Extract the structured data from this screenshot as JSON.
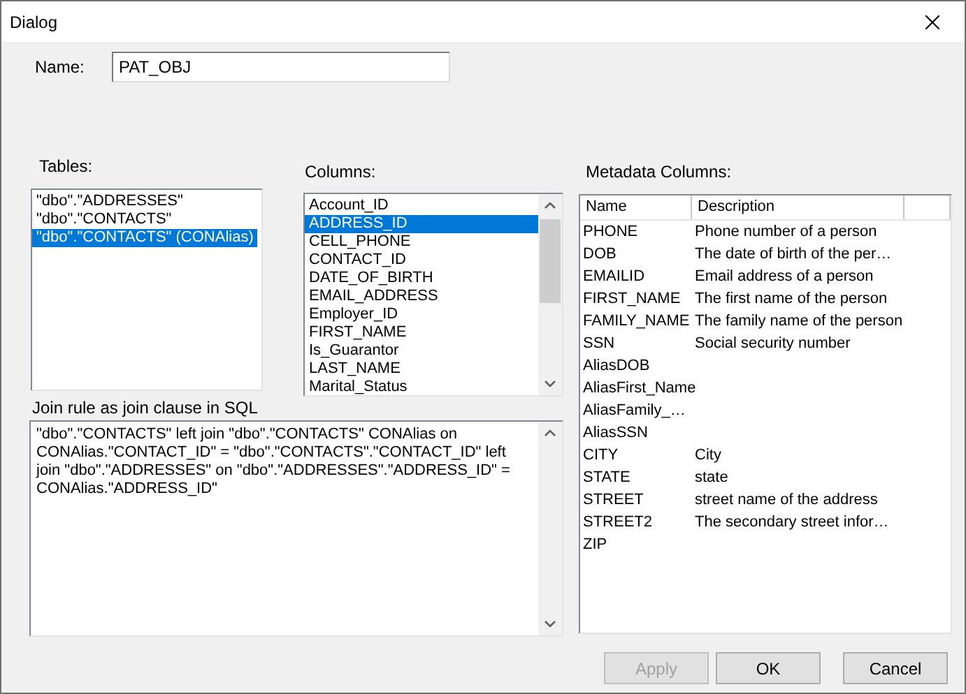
{
  "window": {
    "title": "Dialog"
  },
  "name_field": {
    "label": "Name:",
    "value": "PAT_OBJ"
  },
  "tables": {
    "label": "Tables:",
    "items": [
      {
        "text": "\"dbo\".\"ADDRESSES\"",
        "selected": false
      },
      {
        "text": "\"dbo\".\"CONTACTS\"",
        "selected": false
      },
      {
        "text": "\"dbo\".\"CONTACTS\" (CONAlias)",
        "selected": true
      }
    ]
  },
  "columns": {
    "label": "Columns:",
    "items": [
      {
        "text": "Account_ID",
        "selected": false
      },
      {
        "text": "ADDRESS_ID",
        "selected": true
      },
      {
        "text": "CELL_PHONE",
        "selected": false
      },
      {
        "text": "CONTACT_ID",
        "selected": false
      },
      {
        "text": "DATE_OF_BIRTH",
        "selected": false
      },
      {
        "text": "EMAIL_ADDRESS",
        "selected": false
      },
      {
        "text": "Employer_ID",
        "selected": false
      },
      {
        "text": "FIRST_NAME",
        "selected": false
      },
      {
        "text": "Is_Guarantor",
        "selected": false
      },
      {
        "text": "LAST_NAME",
        "selected": false
      },
      {
        "text": "Marital_Status",
        "selected": false
      }
    ]
  },
  "join_rule": {
    "label": "Join rule as join clause in SQL",
    "text": "\"dbo\".\"CONTACTS\" left join \"dbo\".\"CONTACTS\" CONAlias on CONAlias.\"CONTACT_ID\" = \"dbo\".\"CONTACTS\".\"CONTACT_ID\" left join \"dbo\".\"ADDRESSES\" on \"dbo\".\"ADDRESSES\".\"ADDRESS_ID\" = CONAlias.\"ADDRESS_ID\""
  },
  "metadata": {
    "label": "Metadata Columns:",
    "headers": [
      "Name",
      "Description"
    ],
    "rows": [
      {
        "name": "PHONE",
        "description": "Phone number of a person"
      },
      {
        "name": "DOB",
        "description": "The date of birth of the per…"
      },
      {
        "name": "EMAILID",
        "description": "Email address of a person"
      },
      {
        "name": "FIRST_NAME",
        "description": "The first name of the person"
      },
      {
        "name": "FAMILY_NAME",
        "description": "The family name of the person"
      },
      {
        "name": "SSN",
        "description": "Social security number"
      },
      {
        "name": "AliasDOB"
      },
      {
        "name": "AliasFirst_Name"
      },
      {
        "name": "AliasFamily_…"
      },
      {
        "name": "AliasSSN"
      },
      {
        "name": "CITY",
        "description": "City"
      },
      {
        "name": "STATE",
        "description": "state"
      },
      {
        "name": "STREET",
        "description": "street name of the address"
      },
      {
        "name": "STREET2",
        "description": "The secondary street infor…"
      },
      {
        "name": "ZIP"
      }
    ]
  },
  "buttons": [
    {
      "label": "Apply",
      "disabled": true
    },
    {
      "label": "OK",
      "disabled": false
    },
    {
      "label": "Cancel",
      "disabled": false
    }
  ]
}
